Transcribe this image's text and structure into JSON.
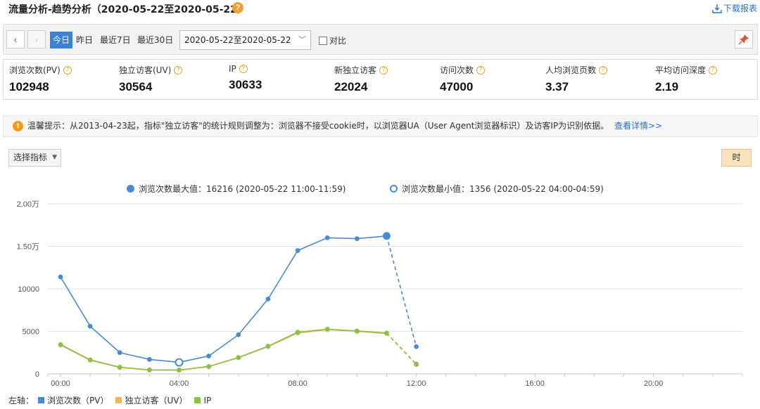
{
  "header": {
    "title": "流量分析-趋势分析（2020-05-22至2020-05-22）",
    "help_icon": "?",
    "download_label": "下载报表"
  },
  "toolbar": {
    "prev_icon": "chevron-left-icon",
    "next_icon": "chevron-right-icon",
    "tabs": [
      {
        "label": "今日",
        "active": true
      },
      {
        "label": "昨日",
        "active": false
      },
      {
        "label": "最近7日",
        "active": false
      },
      {
        "label": "最近30日",
        "active": false
      }
    ],
    "date_range": "2020-05-22至2020-05-22",
    "compare_label": "对比",
    "compare_checked": false,
    "pin_icon": "pin-icon"
  },
  "metrics": [
    {
      "label": "浏览次数(PV)",
      "value": "102948"
    },
    {
      "label": "独立访客(UV)",
      "value": "30564"
    },
    {
      "label": "IP",
      "value": "30633"
    },
    {
      "label": "新独立访客",
      "value": "22024"
    },
    {
      "label": "访问次数",
      "value": "47000"
    },
    {
      "label": "人均浏览页数",
      "value": "3.37"
    },
    {
      "label": "平均访问深度",
      "value": "2.19"
    }
  ],
  "notice": {
    "text": "温馨提示：从2013-04-23起，指标\"独立访客\"的统计规则调整为：浏览器不接受cookie时，以浏览器UA（User Agent浏览器标识）及访客IP为识别依据。",
    "link": "查看详情>>"
  },
  "controls": {
    "metric_select": "选择指标",
    "granularity": "时"
  },
  "chart_data": {
    "type": "line",
    "max_label": "浏览次数最大值：16216 (2020-05-22 11:00-11:59)",
    "min_label": "浏览次数最小值：1356 (2020-05-22 04:00-04:59)",
    "x": [
      0,
      1,
      2,
      3,
      4,
      5,
      6,
      7,
      8,
      9,
      10,
      11,
      12
    ],
    "x_ticks": [
      "00:00",
      "04:00",
      "08:00",
      "12:00",
      "16:00",
      "20:00"
    ],
    "y_ticks": [
      "0",
      "5000",
      "10000",
      "1.50万",
      "2.00万"
    ],
    "ylim": [
      0,
      20000
    ],
    "xlim": [
      0,
      23
    ],
    "dashed_from_index": 11,
    "series": [
      {
        "name": "浏览次数（PV）",
        "color": "#4a8ad2",
        "values": [
          11400,
          5600,
          2500,
          1700,
          1356,
          2100,
          4600,
          8800,
          14500,
          16000,
          15900,
          16216,
          3200
        ]
      },
      {
        "name": "独立访客（UV）",
        "color": "#f0b45a",
        "values": [
          3400,
          1600,
          750,
          450,
          430,
          850,
          1900,
          3200,
          4800,
          5200,
          5000,
          4750,
          1100
        ]
      },
      {
        "name": "IP",
        "color": "#8ac149",
        "values": [
          3450,
          1650,
          780,
          470,
          450,
          870,
          1920,
          3250,
          4900,
          5250,
          5050,
          4800,
          1150
        ]
      }
    ],
    "max_index": 11,
    "min_index": 4,
    "y_axis_label": "左轴："
  }
}
